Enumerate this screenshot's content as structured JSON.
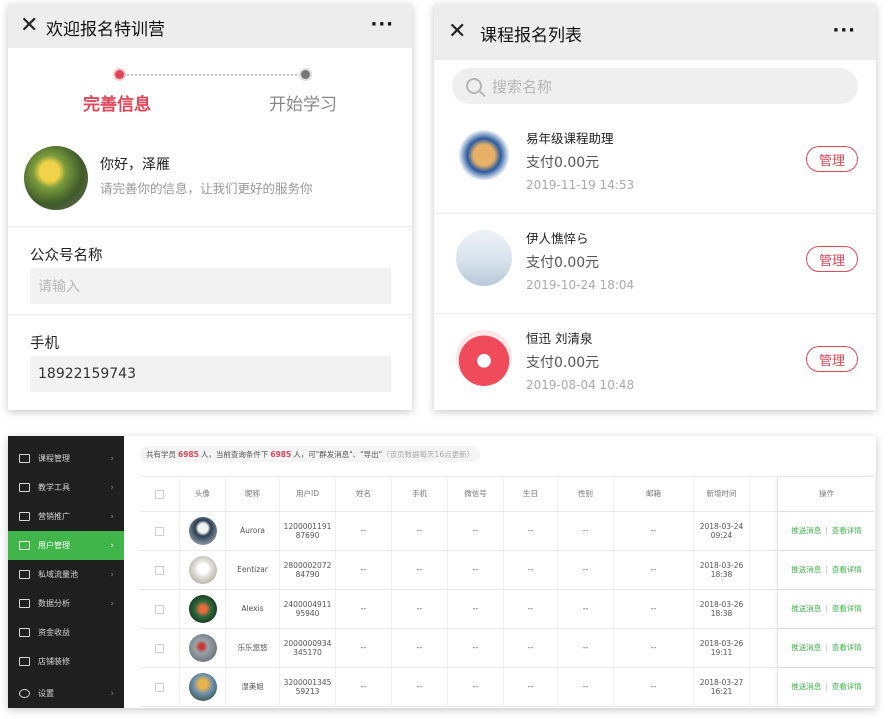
{
  "enroll": {
    "title": "欢迎报名特训营",
    "more": "···",
    "close": "✕",
    "steps": [
      {
        "label": "完善信息",
        "active": true
      },
      {
        "label": "开始学习",
        "active": false
      }
    ],
    "greeting": "你好，泽雁",
    "greeting_sub": "请完善你的信息，让我们更好的服务你",
    "fields": [
      {
        "label": "公众号名称",
        "value": "",
        "placeholder": "请输入"
      },
      {
        "label": "手机",
        "value": "18922159743",
        "placeholder": ""
      }
    ]
  },
  "course_list": {
    "title": "课程报名列表",
    "more": "···",
    "close": "✕",
    "search_placeholder": "搜索名称",
    "items": [
      {
        "name": "易年级课程助理",
        "pay": "支付0.00元",
        "date": "2019-11-19 14:53",
        "action": "管理"
      },
      {
        "name": "伊人憔悴ら",
        "pay": "支付0.00元",
        "date": "2019-10-24 18:04",
        "action": "管理"
      },
      {
        "name": "恒迅 刘清泉",
        "pay": "支付0.00元",
        "date": "2019-08-04 10:48",
        "action": "管理"
      }
    ]
  },
  "admin": {
    "sidebar": [
      {
        "label": "课程管理",
        "icon": "grid-icon",
        "active": false
      },
      {
        "label": "教学工具",
        "icon": "tools-icon",
        "active": false
      },
      {
        "label": "营销推广",
        "icon": "sign-icon",
        "active": false
      },
      {
        "label": "用户管理",
        "icon": "users-icon",
        "active": true
      },
      {
        "label": "私域流量池",
        "icon": "pool-icon",
        "active": false
      },
      {
        "label": "数据分析",
        "icon": "chart-icon",
        "active": false
      },
      {
        "label": "资金收益",
        "icon": "money-icon",
        "active": false
      },
      {
        "label": "店铺装修",
        "icon": "store-icon",
        "active": false
      },
      {
        "label": "设置",
        "icon": "gear-icon",
        "active": false
      }
    ],
    "notice": {
      "p1": "共有学员",
      "total": "6985",
      "p2": "人，当前查询条件下",
      "current": "6985",
      "p3": "人，可\"群发消息\"、\"导出\"",
      "p4": "（该页数据每天16点更新）"
    },
    "columns": [
      "",
      "头像",
      "昵称",
      "用户ID",
      "姓名",
      "手机",
      "微信号",
      "生日",
      "性别",
      "邮箱",
      "新增时间",
      "",
      "操作"
    ],
    "rows": [
      {
        "nick": "Aurora",
        "uid": "1200001191\n87690",
        "name": "--",
        "phone": "--",
        "wechat": "--",
        "birthday": "--",
        "gender": "--",
        "email": "--",
        "time": "2018-03-24\n09:24"
      },
      {
        "nick": "Eentizar",
        "uid": "2800002072\n84790",
        "name": "--",
        "phone": "--",
        "wechat": "--",
        "birthday": "--",
        "gender": "--",
        "email": "--",
        "time": "2018-03-26\n18:38"
      },
      {
        "nick": "Alexis",
        "uid": "2400004911\n95940",
        "name": "--",
        "phone": "--",
        "wechat": "--",
        "birthday": "--",
        "gender": "--",
        "email": "--",
        "time": "2018-03-26\n18:38"
      },
      {
        "nick": "乐乐悠悠",
        "uid": "2000000934\n345170",
        "name": "--",
        "phone": "--",
        "wechat": "--",
        "birthday": "--",
        "gender": "--",
        "email": "--",
        "time": "2018-03-26\n19:11"
      },
      {
        "nick": "湿美姐",
        "uid": "3200001345\n59213",
        "name": "--",
        "phone": "--",
        "wechat": "--",
        "birthday": "--",
        "gender": "--",
        "email": "--",
        "time": "2018-03-27\n16:21"
      }
    ],
    "op_send": "推送消息",
    "op_sep": "|",
    "op_detail": "查看详情"
  },
  "colors": {
    "accent_red": "#e34659",
    "accent_green": "#3fb54a",
    "sidebar_bg": "#1f1f1f"
  }
}
